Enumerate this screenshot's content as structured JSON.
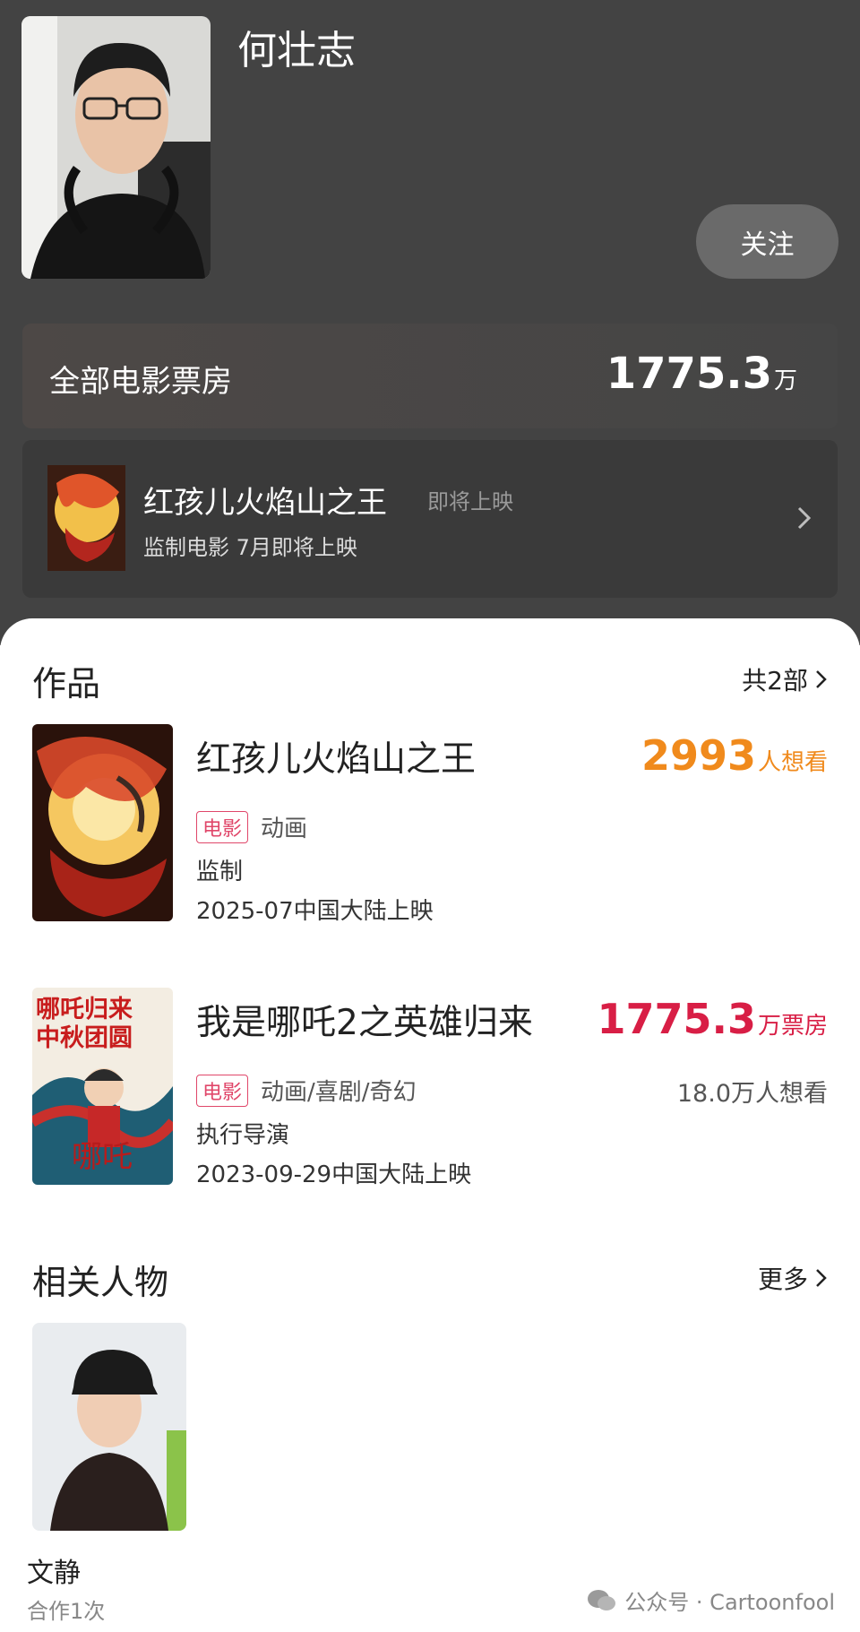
{
  "profile": {
    "name": "何壮志",
    "follow_label": "关注"
  },
  "boxoffice": {
    "label": "全部电影票房",
    "value": "1775.3",
    "unit": "万"
  },
  "upcoming": {
    "title": "红孩儿火焰山之王",
    "status": "即将上映",
    "subtitle": "监制电影 7月即将上映"
  },
  "works": {
    "title": "作品",
    "more": "共2部",
    "items": [
      {
        "title": "红孩儿火焰山之王",
        "metric_value": "2993",
        "metric_unit": "人想看",
        "metric_color": "#f08a1c",
        "tag": "电影",
        "genre": "动画",
        "role": "监制",
        "date": "2025-07中国大陆上映",
        "want": ""
      },
      {
        "title": "我是哪吒2之英雄归来",
        "metric_value": "1775.3",
        "metric_unit": "万票房",
        "metric_color": "#d81e45",
        "tag": "电影",
        "genre": "动画/喜剧/奇幻",
        "role": "执行导演",
        "date": "2023-09-29中国大陆上映",
        "want": "18.0万人想看",
        "poster_text_1": "哪吒归来",
        "poster_text_2": "中秋团圆"
      }
    ]
  },
  "related": {
    "title": "相关人物",
    "more": "更多",
    "people": [
      {
        "name": "文静",
        "sub": "合作1次"
      }
    ]
  },
  "watermark": "公众号 · Cartoonfool"
}
